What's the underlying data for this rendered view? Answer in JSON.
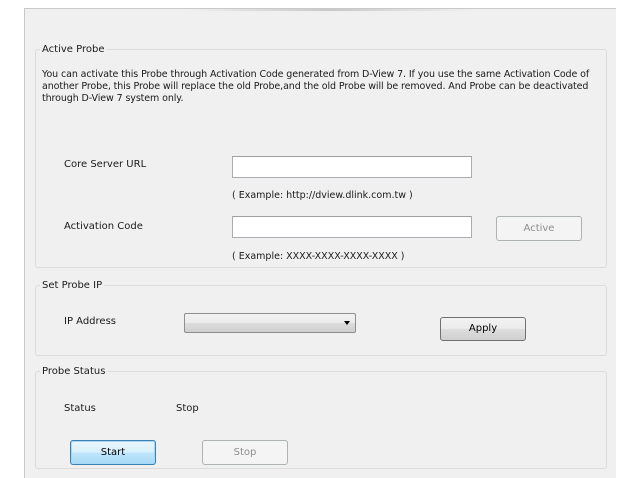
{
  "active_probe": {
    "title": "Active Probe",
    "description": "You can activate this Probe through Activation Code generated from D-View 7. If you use the same Activation Code of another Probe, this Probe will replace the old Probe,and the old Probe will be removed. And Probe can be deactivated through D-View 7 system only.",
    "core_server_url": {
      "label": "Core Server URL",
      "value": "",
      "example": "( Example: http://dview.dlink.com.tw )"
    },
    "activation_code": {
      "label": "Activation Code",
      "value": "",
      "example": "( Example: XXXX-XXXX-XXXX-XXXX )"
    },
    "active_button": "Active"
  },
  "set_probe_ip": {
    "title": "Set Probe IP",
    "ip_address_label": "IP Address",
    "ip_address_selected": "",
    "apply_button": "Apply"
  },
  "probe_status": {
    "title": "Probe Status",
    "status_label": "Status",
    "status_value": "Stop",
    "start_button": "Start",
    "stop_button": "Stop"
  },
  "icons": {
    "dropdown": "chevron-down-icon"
  }
}
